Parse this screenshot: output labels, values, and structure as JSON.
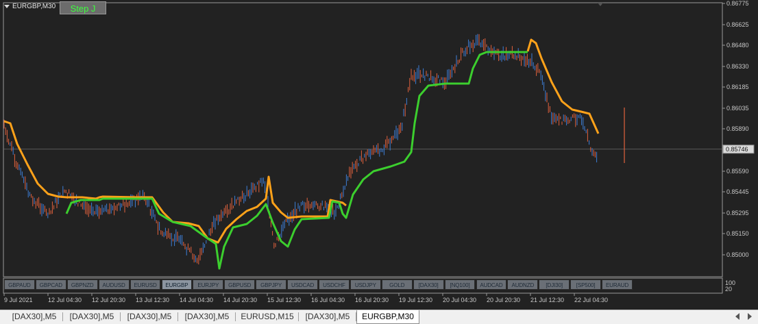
{
  "chart": {
    "title": "EURGBP,M30",
    "step_button": "Step J",
    "current_price": "0.85746",
    "price_scale": [
      "0.86775",
      "0.86625",
      "0.86480",
      "0.86330",
      "0.86185",
      "0.86035",
      "0.85890",
      "0.85590",
      "0.85445",
      "0.85295",
      "0.85150",
      "0.85000"
    ],
    "time_labels": [
      "9 Jul 2021",
      "12 Jul 04:30",
      "12 Jul 20:30",
      "13 Jul 12:30",
      "14 Jul 04:30",
      "14 Jul 20:30",
      "15 Jul 12:30",
      "16 Jul 04:30",
      "16 Jul 20:30",
      "19 Jul 12:30",
      "20 Jul 04:30",
      "20 Jul 20:30",
      "21 Jul 12:30",
      "22 Jul 04:30"
    ],
    "indicator_scale": [
      "100",
      "20"
    ],
    "symbol_buttons": [
      "GBPAUD",
      "GBPCAD",
      "GBPNZD",
      "AUDUSD",
      "EURUSD",
      "EURGBP",
      "EURJPY",
      "GBPUSD",
      "GBPJPY",
      "USDCAD",
      "USDCHF",
      "USDJPY",
      "GOLD",
      "[DAX30]",
      "[NQ100]",
      "AUDCAD",
      "AUDNZD",
      "[DJI30]",
      "[SP500]",
      "EURAUD"
    ],
    "active_symbol": "EURGBP",
    "colors": {
      "background": "#222222",
      "bull_candle": "#3d7fd8",
      "bear_candle": "#e2623e",
      "fast_line": "#3ccf2e",
      "slow_line": "#ffa21a",
      "text": "#c8c8c8"
    }
  },
  "tabs": [
    "[DAX30],M5",
    "[DAX30],M5",
    "[DAX30],M5",
    "[DAX30],M5",
    "EURUSD,M15",
    "[DAX30],M5",
    "EURGBP,M30"
  ],
  "active_tab": "EURGBP,M30"
}
